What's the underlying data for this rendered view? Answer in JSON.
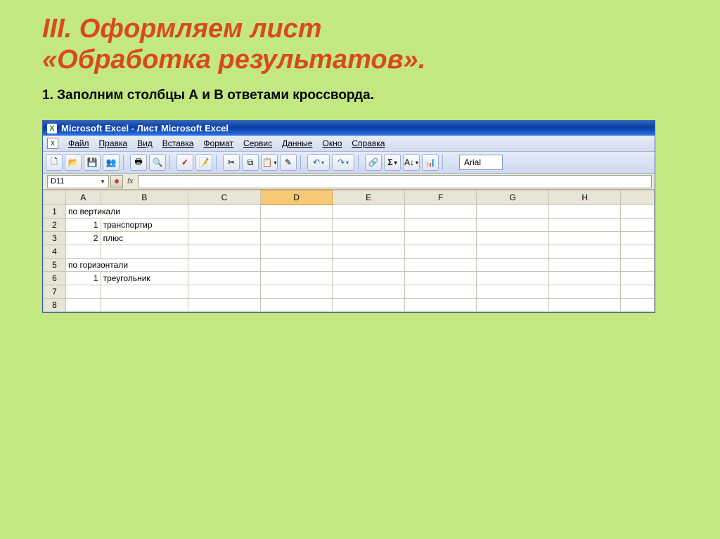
{
  "slide": {
    "title_line1": "III. Оформляем  лист",
    "title_line2": "«Обработка результатов».",
    "subtitle": "1. Заполним столбцы А и В ответами кроссворда."
  },
  "excel": {
    "titlebar": "Microsoft Excel - Лист Microsoft Excel",
    "menus": [
      "Файл",
      "Правка",
      "Вид",
      "Вставка",
      "Формат",
      "Сервис",
      "Данные",
      "Окно",
      "Справка"
    ],
    "font": "Arial",
    "namebox": "D11",
    "columns": [
      "A",
      "B",
      "C",
      "D",
      "E",
      "F",
      "G",
      "H"
    ],
    "active_column": "D",
    "rows": [
      {
        "n": 1,
        "A": "по вертикали",
        "B": "",
        "merged": true
      },
      {
        "n": 2,
        "A": "1",
        "B": "транспортир"
      },
      {
        "n": 3,
        "A": "2",
        "B": "плюс"
      },
      {
        "n": 4,
        "A": "",
        "B": ""
      },
      {
        "n": 5,
        "A": "по горизонтали",
        "B": "",
        "merged": true
      },
      {
        "n": 6,
        "A": "1",
        "B": "треугольник"
      },
      {
        "n": 7,
        "A": "",
        "B": ""
      },
      {
        "n": 8,
        "A": "",
        "B": ""
      }
    ],
    "icons": {
      "app": "X",
      "new": "🗋",
      "open": "📂",
      "save": "💾",
      "perm": "👥",
      "print": "🖶",
      "preview": "🔍",
      "spell": "✓",
      "research": "📝",
      "cut": "✂",
      "copy": "⧉",
      "paste": "📋",
      "fmt": "✎",
      "undo": "↶",
      "redo": "↷",
      "link": "🔗",
      "sum": "Σ",
      "sort": "A↓",
      "chart": "📊"
    }
  }
}
